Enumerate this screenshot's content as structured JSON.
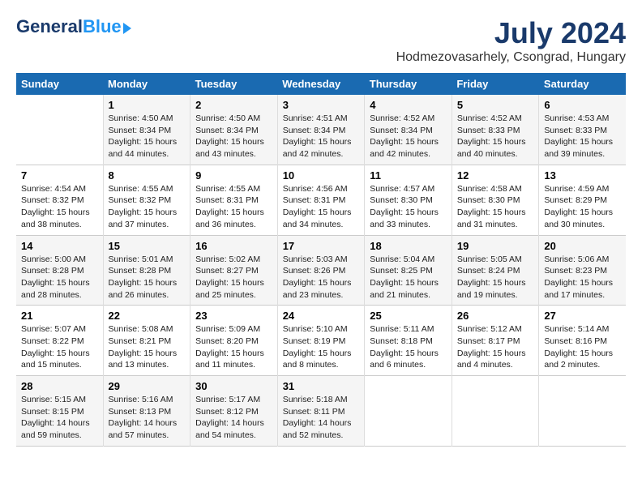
{
  "header": {
    "logo_general": "General",
    "logo_blue": "Blue",
    "title": "July 2024",
    "subtitle": "Hodmezovasarhely, Csongrad, Hungary"
  },
  "columns": [
    "Sunday",
    "Monday",
    "Tuesday",
    "Wednesday",
    "Thursday",
    "Friday",
    "Saturday"
  ],
  "weeks": [
    [
      {
        "day": "",
        "info": ""
      },
      {
        "day": "1",
        "info": "Sunrise: 4:50 AM\nSunset: 8:34 PM\nDaylight: 15 hours\nand 44 minutes."
      },
      {
        "day": "2",
        "info": "Sunrise: 4:50 AM\nSunset: 8:34 PM\nDaylight: 15 hours\nand 43 minutes."
      },
      {
        "day": "3",
        "info": "Sunrise: 4:51 AM\nSunset: 8:34 PM\nDaylight: 15 hours\nand 42 minutes."
      },
      {
        "day": "4",
        "info": "Sunrise: 4:52 AM\nSunset: 8:34 PM\nDaylight: 15 hours\nand 42 minutes."
      },
      {
        "day": "5",
        "info": "Sunrise: 4:52 AM\nSunset: 8:33 PM\nDaylight: 15 hours\nand 40 minutes."
      },
      {
        "day": "6",
        "info": "Sunrise: 4:53 AM\nSunset: 8:33 PM\nDaylight: 15 hours\nand 39 minutes."
      }
    ],
    [
      {
        "day": "7",
        "info": "Sunrise: 4:54 AM\nSunset: 8:32 PM\nDaylight: 15 hours\nand 38 minutes."
      },
      {
        "day": "8",
        "info": "Sunrise: 4:55 AM\nSunset: 8:32 PM\nDaylight: 15 hours\nand 37 minutes."
      },
      {
        "day": "9",
        "info": "Sunrise: 4:55 AM\nSunset: 8:31 PM\nDaylight: 15 hours\nand 36 minutes."
      },
      {
        "day": "10",
        "info": "Sunrise: 4:56 AM\nSunset: 8:31 PM\nDaylight: 15 hours\nand 34 minutes."
      },
      {
        "day": "11",
        "info": "Sunrise: 4:57 AM\nSunset: 8:30 PM\nDaylight: 15 hours\nand 33 minutes."
      },
      {
        "day": "12",
        "info": "Sunrise: 4:58 AM\nSunset: 8:30 PM\nDaylight: 15 hours\nand 31 minutes."
      },
      {
        "day": "13",
        "info": "Sunrise: 4:59 AM\nSunset: 8:29 PM\nDaylight: 15 hours\nand 30 minutes."
      }
    ],
    [
      {
        "day": "14",
        "info": "Sunrise: 5:00 AM\nSunset: 8:28 PM\nDaylight: 15 hours\nand 28 minutes."
      },
      {
        "day": "15",
        "info": "Sunrise: 5:01 AM\nSunset: 8:28 PM\nDaylight: 15 hours\nand 26 minutes."
      },
      {
        "day": "16",
        "info": "Sunrise: 5:02 AM\nSunset: 8:27 PM\nDaylight: 15 hours\nand 25 minutes."
      },
      {
        "day": "17",
        "info": "Sunrise: 5:03 AM\nSunset: 8:26 PM\nDaylight: 15 hours\nand 23 minutes."
      },
      {
        "day": "18",
        "info": "Sunrise: 5:04 AM\nSunset: 8:25 PM\nDaylight: 15 hours\nand 21 minutes."
      },
      {
        "day": "19",
        "info": "Sunrise: 5:05 AM\nSunset: 8:24 PM\nDaylight: 15 hours\nand 19 minutes."
      },
      {
        "day": "20",
        "info": "Sunrise: 5:06 AM\nSunset: 8:23 PM\nDaylight: 15 hours\nand 17 minutes."
      }
    ],
    [
      {
        "day": "21",
        "info": "Sunrise: 5:07 AM\nSunset: 8:22 PM\nDaylight: 15 hours\nand 15 minutes."
      },
      {
        "day": "22",
        "info": "Sunrise: 5:08 AM\nSunset: 8:21 PM\nDaylight: 15 hours\nand 13 minutes."
      },
      {
        "day": "23",
        "info": "Sunrise: 5:09 AM\nSunset: 8:20 PM\nDaylight: 15 hours\nand 11 minutes."
      },
      {
        "day": "24",
        "info": "Sunrise: 5:10 AM\nSunset: 8:19 PM\nDaylight: 15 hours\nand 8 minutes."
      },
      {
        "day": "25",
        "info": "Sunrise: 5:11 AM\nSunset: 8:18 PM\nDaylight: 15 hours\nand 6 minutes."
      },
      {
        "day": "26",
        "info": "Sunrise: 5:12 AM\nSunset: 8:17 PM\nDaylight: 15 hours\nand 4 minutes."
      },
      {
        "day": "27",
        "info": "Sunrise: 5:14 AM\nSunset: 8:16 PM\nDaylight: 15 hours\nand 2 minutes."
      }
    ],
    [
      {
        "day": "28",
        "info": "Sunrise: 5:15 AM\nSunset: 8:15 PM\nDaylight: 14 hours\nand 59 minutes."
      },
      {
        "day": "29",
        "info": "Sunrise: 5:16 AM\nSunset: 8:13 PM\nDaylight: 14 hours\nand 57 minutes."
      },
      {
        "day": "30",
        "info": "Sunrise: 5:17 AM\nSunset: 8:12 PM\nDaylight: 14 hours\nand 54 minutes."
      },
      {
        "day": "31",
        "info": "Sunrise: 5:18 AM\nSunset: 8:11 PM\nDaylight: 14 hours\nand 52 minutes."
      },
      {
        "day": "",
        "info": ""
      },
      {
        "day": "",
        "info": ""
      },
      {
        "day": "",
        "info": ""
      }
    ]
  ]
}
